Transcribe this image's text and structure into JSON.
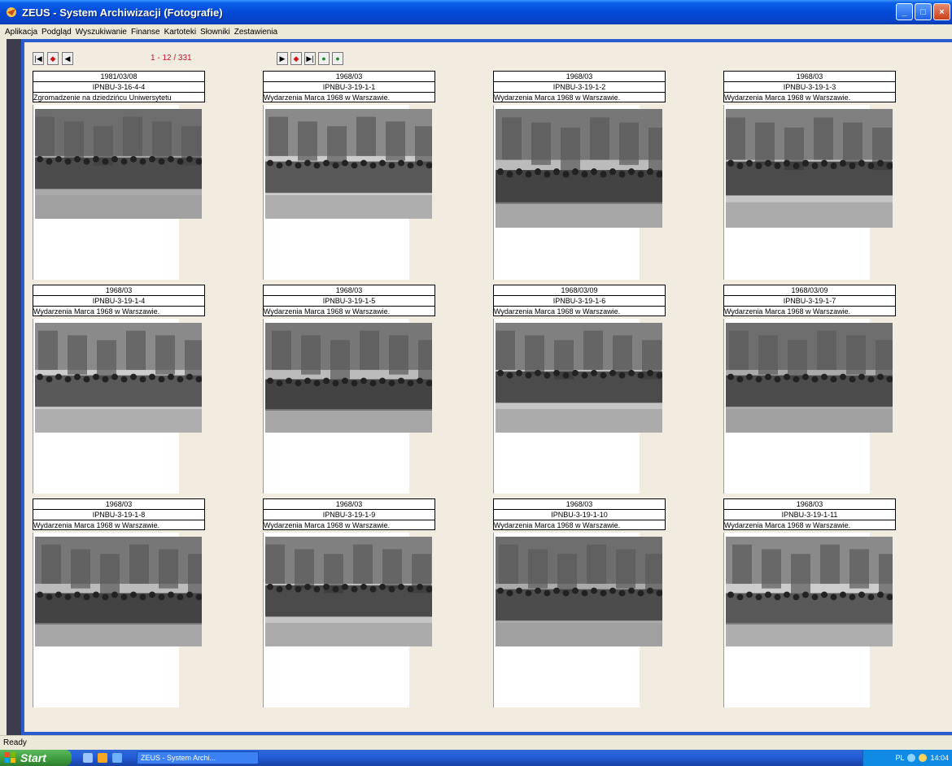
{
  "window": {
    "title": "ZEUS - System Archiwizacji  (Fotografie)",
    "icon": "zeus-app-icon",
    "controls": [
      "minimize",
      "maximize",
      "close"
    ]
  },
  "menu": [
    "Aplikacja",
    "Podgląd",
    "Wyszukiwanie",
    "Finanse",
    "Kartoteki",
    "Słowniki",
    "Zestawienia"
  ],
  "navigation": {
    "counter": "1 - 12 / 331",
    "left_buttons": [
      "first-icon",
      "prev-red-icon",
      "prev-icon"
    ],
    "right_buttons": [
      "next-icon",
      "next-red-icon",
      "last-icon",
      "green-refresh-icon",
      "green-camera-icon"
    ]
  },
  "cards": [
    {
      "date": "1981/03/08",
      "id": "IPNBU-3-16-4-4",
      "desc": "Zgromadzenie na dziedzińcu Uniwersytetu"
    },
    {
      "date": "1968/03",
      "id": "IPNBU-3-19-1-1",
      "desc": "Wydarzenia Marca 1968 w Warszawie."
    },
    {
      "date": "1968/03",
      "id": "IPNBU-3-19-1-2",
      "desc": "Wydarzenia Marca 1968 w Warszawie."
    },
    {
      "date": "1968/03",
      "id": "IPNBU-3-19-1-3",
      "desc": "Wydarzenia Marca 1968 w Warszawie."
    },
    {
      "date": "1968/03",
      "id": "IPNBU-3-19-1-4",
      "desc": "Wydarzenia Marca 1968 w Warszawie."
    },
    {
      "date": "1968/03",
      "id": "IPNBU-3-19-1-5",
      "desc": "Wydarzenia Marca 1968 w Warszawie."
    },
    {
      "date": "1968/03/09",
      "id": "IPNBU-3-19-1-6",
      "desc": "Wydarzenia Marca 1968 w Warszawie."
    },
    {
      "date": "1968/03/09",
      "id": "IPNBU-3-19-1-7",
      "desc": "Wydarzenia Marca 1968 w Warszawie."
    },
    {
      "date": "1968/03",
      "id": "IPNBU-3-19-1-8",
      "desc": "Wydarzenia Marca 1968 w Warszawie."
    },
    {
      "date": "1968/03",
      "id": "IPNBU-3-19-1-9",
      "desc": "Wydarzenia Marca 1968 w Warszawie."
    },
    {
      "date": "1968/03",
      "id": "IPNBU-3-19-1-10",
      "desc": "Wydarzenia Marca 1968 w Warszawie."
    },
    {
      "date": "1968/03",
      "id": "IPNBU-3-19-1-11",
      "desc": "Wydarzenia Marca 1968 w Warszawie."
    }
  ],
  "status": "Ready",
  "taskbar": {
    "start_label": "Start",
    "task_label": "ZEUS - System Archi...",
    "tray_lang": "PL",
    "tray_time": "14:04"
  },
  "colors": {
    "titlebar": "#0349d8",
    "frame_border": "#2a5ccf",
    "counter": "#c8102e",
    "panel_bg": "#f1ecdf"
  }
}
